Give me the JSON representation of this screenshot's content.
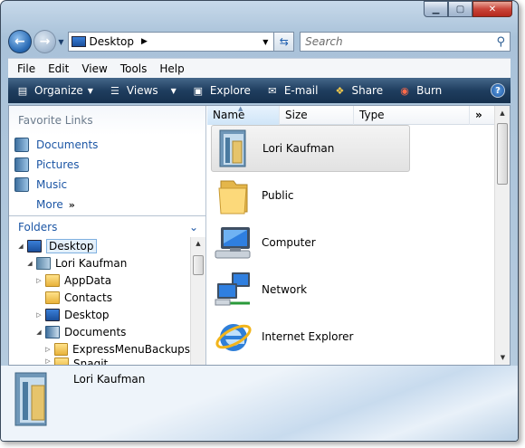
{
  "window": {
    "buttons": {
      "minimize_icon": "minimize-icon",
      "maximize_icon": "maximize-icon",
      "close_icon": "close-icon"
    }
  },
  "address": {
    "location": "Desktop",
    "search_placeholder": "Search"
  },
  "menu": [
    "File",
    "Edit",
    "View",
    "Tools",
    "Help"
  ],
  "commands": {
    "organize": "Organize",
    "views": "Views",
    "explore": "Explore",
    "email": "E-mail",
    "share": "Share",
    "burn": "Burn"
  },
  "favorites": {
    "header": "Favorite Links",
    "items": [
      "Documents",
      "Pictures",
      "Music",
      "More"
    ]
  },
  "folders": {
    "header": "Folders",
    "tree": [
      {
        "label": "Desktop",
        "level": 0,
        "expander": "expanded"
      },
      {
        "label": "Lori Kaufman",
        "level": 1,
        "expander": "expanded"
      },
      {
        "label": "AppData",
        "level": 2,
        "expander": "collapsed"
      },
      {
        "label": "Contacts",
        "level": 2,
        "expander": "none"
      },
      {
        "label": "Desktop",
        "level": 2,
        "expander": "collapsed"
      },
      {
        "label": "Documents",
        "level": 2,
        "expander": "expanded"
      },
      {
        "label": "ExpressMenuBackups",
        "level": 3,
        "expander": "collapsed"
      },
      {
        "label": "Snagit",
        "level": 3,
        "expander": "collapsed"
      }
    ]
  },
  "columns": {
    "name": "Name",
    "size": "Size",
    "type": "Type",
    "more": "»"
  },
  "files": [
    {
      "name": "Lori Kaufman",
      "icon": "user-folder-icon"
    },
    {
      "name": "Public",
      "icon": "folder-icon"
    },
    {
      "name": "Computer",
      "icon": "computer-icon"
    },
    {
      "name": "Network",
      "icon": "network-icon"
    },
    {
      "name": "Internet Explorer",
      "icon": "internet-explorer-icon"
    }
  ],
  "details_pane": {
    "name": "Lori Kaufman"
  }
}
